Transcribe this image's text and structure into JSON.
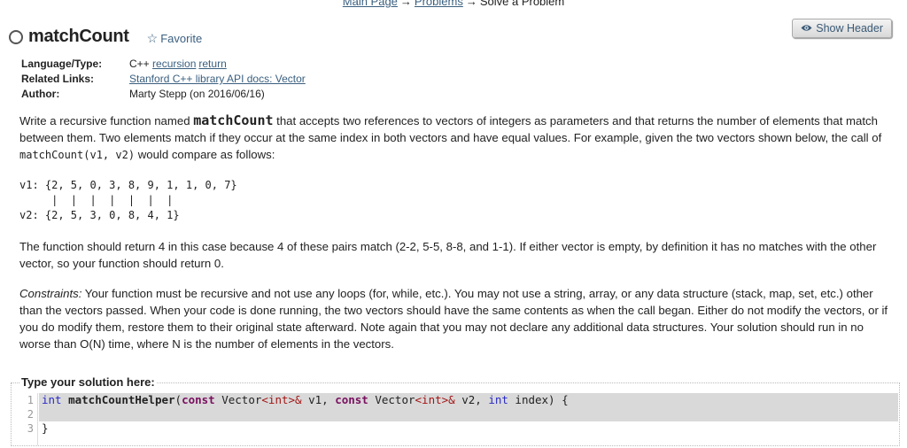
{
  "breadcrumb": {
    "items": [
      {
        "label": "Main Page",
        "link": true
      },
      {
        "label": "Problems",
        "link": true
      },
      {
        "label": "Solve a Problem",
        "link": false
      }
    ],
    "separator": "→"
  },
  "problem": {
    "title": "matchCount",
    "favorite_label": "Favorite",
    "status_icon": "circle-outline-icon"
  },
  "header_button": {
    "label": "Show Header",
    "icon": "eye-icon"
  },
  "meta": {
    "language_label": "Language/Type:",
    "language": "C++",
    "tags": [
      "recursion",
      "return"
    ],
    "related_label": "Related Links:",
    "related_link": "Stanford C++ library API docs: Vector",
    "author_label": "Author:",
    "author": "Marty Stepp (on 2016/06/16)"
  },
  "description": {
    "p1_a": "Write a recursive function named ",
    "p1_func": "matchCount",
    "p1_b": " that accepts two references to vectors of integers as parameters and that returns the number of elements that match between them. Two elements match if they occur at the same index in both vectors and have equal values. For example, given the two vectors shown below, the call of ",
    "p1_call": "matchCount(v1, v2)",
    "p1_c": " would compare as follows:",
    "example_lines": [
      "v1: {2, 5, 0, 3, 8, 9, 1, 1, 0, 7}",
      "     |  |  |  |  |  |  |",
      "v2: {2, 5, 3, 0, 8, 4, 1}"
    ],
    "p2": "The function should return 4 in this case because 4 of these pairs match (2-2, 5-5, 8-8, and 1-1). If either vector is empty, by definition it has no matches with the other vector, so your function should return 0.",
    "p3_label": "Constraints:",
    "p3": " Your function must be recursive and not use any loops (for, while, etc.). You may not use a string, array, or any data structure (stack, map, set, etc.) other than the vectors passed. When your code is done running, the two vectors should have the same contents as when the call began. Either do not modify the vectors, or if you do modify them, restore them to their original state afterward. Note again that you may not declare any additional data structures. Your solution should run in no worse than O(N) time, where N is the number of elements in the vectors."
  },
  "solution": {
    "legend": "Type your solution here:",
    "line_numbers": [
      "1",
      "2",
      "3"
    ],
    "code": {
      "l1": {
        "t1": "int",
        "t2": " ",
        "t3": "matchCountHelper",
        "t4": "(",
        "t5": "const",
        "t6": " Vector",
        "t7": "<int>&",
        "t8": " v1, ",
        "t9": "const",
        "t10": " Vector",
        "t11": "<int>&",
        "t12": " v2, ",
        "t13": "int",
        "t14": " index) {"
      },
      "l2": "",
      "l3": "}"
    }
  }
}
